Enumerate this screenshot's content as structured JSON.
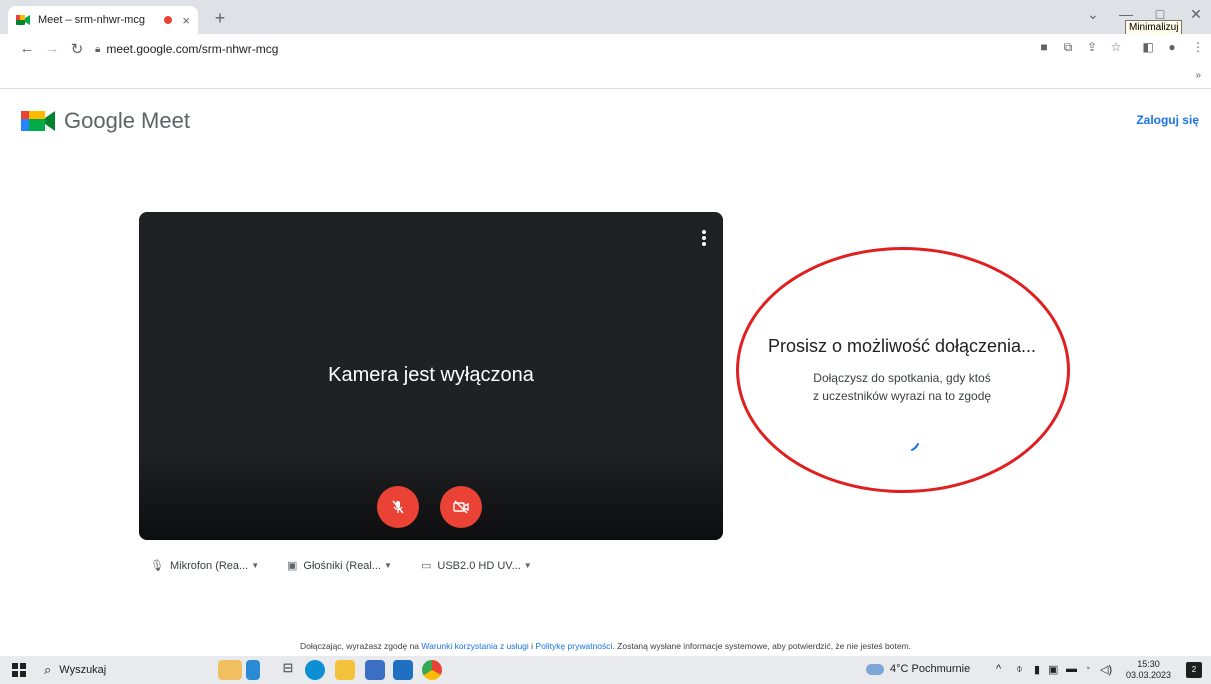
{
  "browser": {
    "tab_title": "Meet – srm-nhwr-mcg",
    "tab_close": "×",
    "new_tab": "+",
    "url": "meet.google.com/srm-nhwr-mcg",
    "tooltip": "Minimalizuj",
    "bookmarks_more": "»"
  },
  "meet": {
    "brand": "Google Meet",
    "sign_in": "Zaloguj się",
    "camera_off": "Kamera jest wyłączona",
    "devices": {
      "microphone": "Mikrofon (Rea...",
      "speakers": "Głośniki (Real...",
      "camera": "USB2.0 HD UV..."
    },
    "status_title": "Prosisz o możliwość dołączenia...",
    "status_line1": "Dołączysz do spotkania, gdy ktoś",
    "status_line2": "z uczestników wyrazi na to zgodę",
    "consent": {
      "prefix": "Dołączając, wyrażasz zgodę na ",
      "terms": "Warunki korzystania z usługi",
      "and": " i ",
      "privacy": "Politykę prywatności",
      "suffix": ". Zostaną wysłane informacje systemowe, aby potwierdzić, że nie jesteś botem."
    },
    "colors": {
      "accent": "#1a73e8",
      "danger": "#ea4335",
      "preview_bg": "#202124"
    }
  },
  "taskbar": {
    "search": "Wyszukaj",
    "weather": "4°C Pochmurnie",
    "time": "15:30",
    "date": "03.03.2023",
    "notifications": "2"
  }
}
